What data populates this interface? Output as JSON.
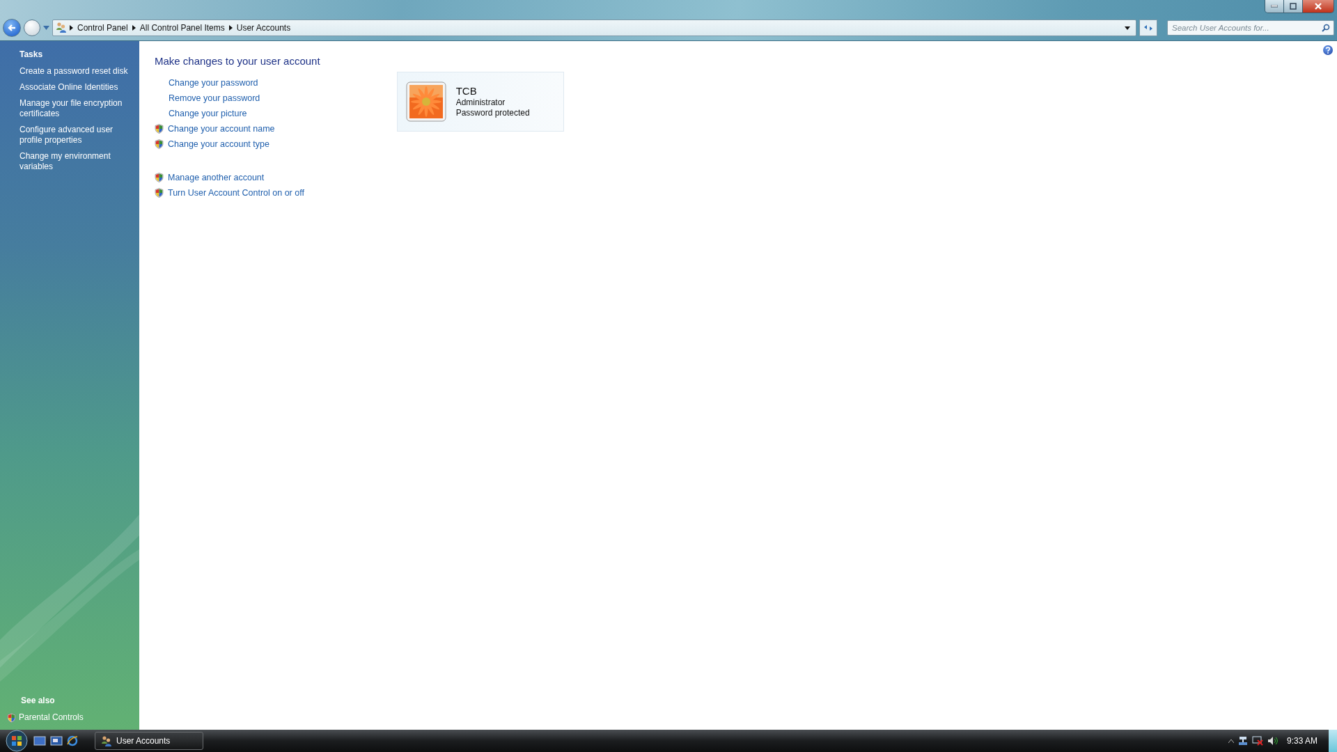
{
  "address_bar": {
    "breadcrumb": [
      "Control Panel",
      "All Control Panel Items",
      "User Accounts"
    ]
  },
  "search": {
    "placeholder": "Search User Accounts for..."
  },
  "sidebar": {
    "tasks_heading": "Tasks",
    "tasks": [
      "Create a password reset disk",
      "Associate Online Identities",
      "Manage your file encryption certificates",
      "Configure advanced user profile properties",
      "Change my environment variables"
    ],
    "see_also_heading": "See also",
    "see_also": [
      {
        "label": "Parental Controls",
        "kind": "shield"
      }
    ]
  },
  "main": {
    "title": "Make changes to your user account",
    "link_groups": [
      [
        {
          "label": "Change your password",
          "kind": "plain"
        },
        {
          "label": "Remove your password",
          "kind": "plain"
        },
        {
          "label": "Change your picture",
          "kind": "plain"
        },
        {
          "label": "Change your account name",
          "kind": "shield"
        },
        {
          "label": "Change your account type",
          "kind": "shield"
        }
      ],
      [
        {
          "label": "Manage another account",
          "kind": "shield"
        },
        {
          "label": "Turn User Account Control on or off",
          "kind": "shield"
        }
      ]
    ],
    "account": {
      "name": "TCB",
      "type": "Administrator",
      "status": "Password protected"
    }
  },
  "taskbar": {
    "window_button": "User Accounts",
    "clock": "9:33 AM"
  }
}
